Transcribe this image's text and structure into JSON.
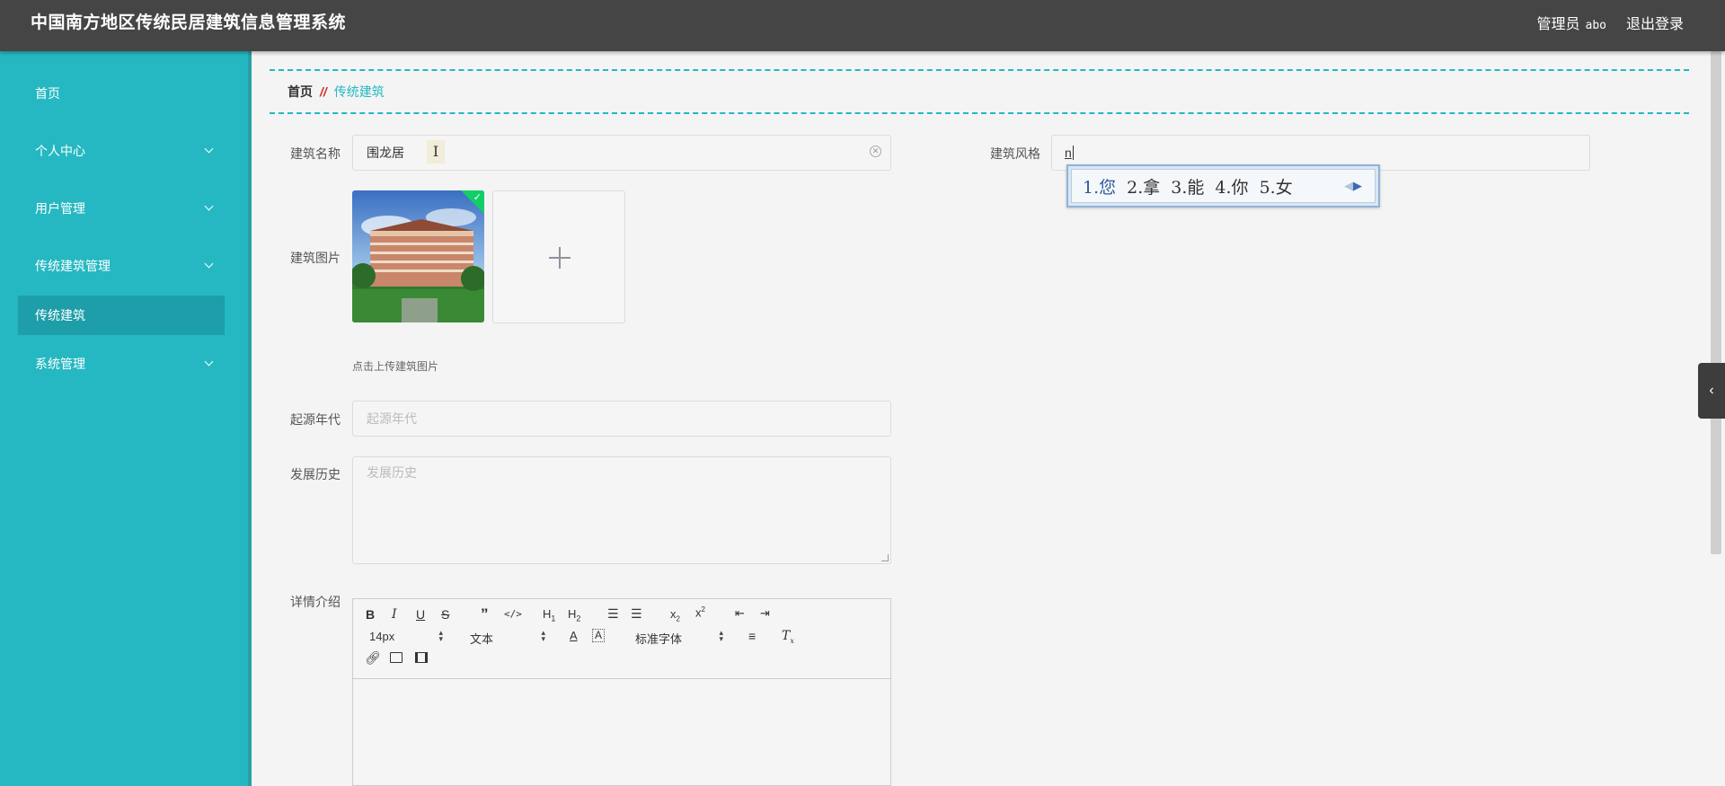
{
  "header": {
    "title": "中国南方地区传统民居建筑信息管理系统",
    "role_label": "管理员",
    "username": "abo",
    "logout_label": "退出登录"
  },
  "sidebar": {
    "items": [
      {
        "label": "首页",
        "has_submenu": false
      },
      {
        "label": "个人中心",
        "has_submenu": true
      },
      {
        "label": "用户管理",
        "has_submenu": true
      },
      {
        "label": "传统建筑管理",
        "has_submenu": true
      },
      {
        "label": "传统建筑",
        "has_submenu": false,
        "active": true
      },
      {
        "label": "系统管理",
        "has_submenu": true
      }
    ]
  },
  "breadcrumb": {
    "home": "首页",
    "separator": "//",
    "current": "传统建筑"
  },
  "form": {
    "name_label": "建筑名称",
    "name_value": "围龙居",
    "cursor_glyph": "I",
    "style_label": "建筑风格",
    "style_value": "n",
    "image_label": "建筑图片",
    "image_hint": "点击上传建筑图片",
    "origin_label": "起源年代",
    "origin_placeholder": "起源年代",
    "history_label": "发展历史",
    "history_placeholder": "发展历史",
    "detail_label": "详情介绍"
  },
  "editor": {
    "font_size": "14px",
    "paragraph_format": "文本",
    "font_family": "标准字体"
  },
  "ime": {
    "candidates": [
      "1.您",
      "2.拿",
      "3.能",
      "4.你",
      "5.女"
    ]
  },
  "colors": {
    "header_bg": "#454545",
    "sidebar_bg": "#25b8c2",
    "sidebar_active": "#1d9ea8",
    "accent": "#25b8c2",
    "breadcrumb_sep": "#d42a2a",
    "upload_check": "#13ce66"
  }
}
